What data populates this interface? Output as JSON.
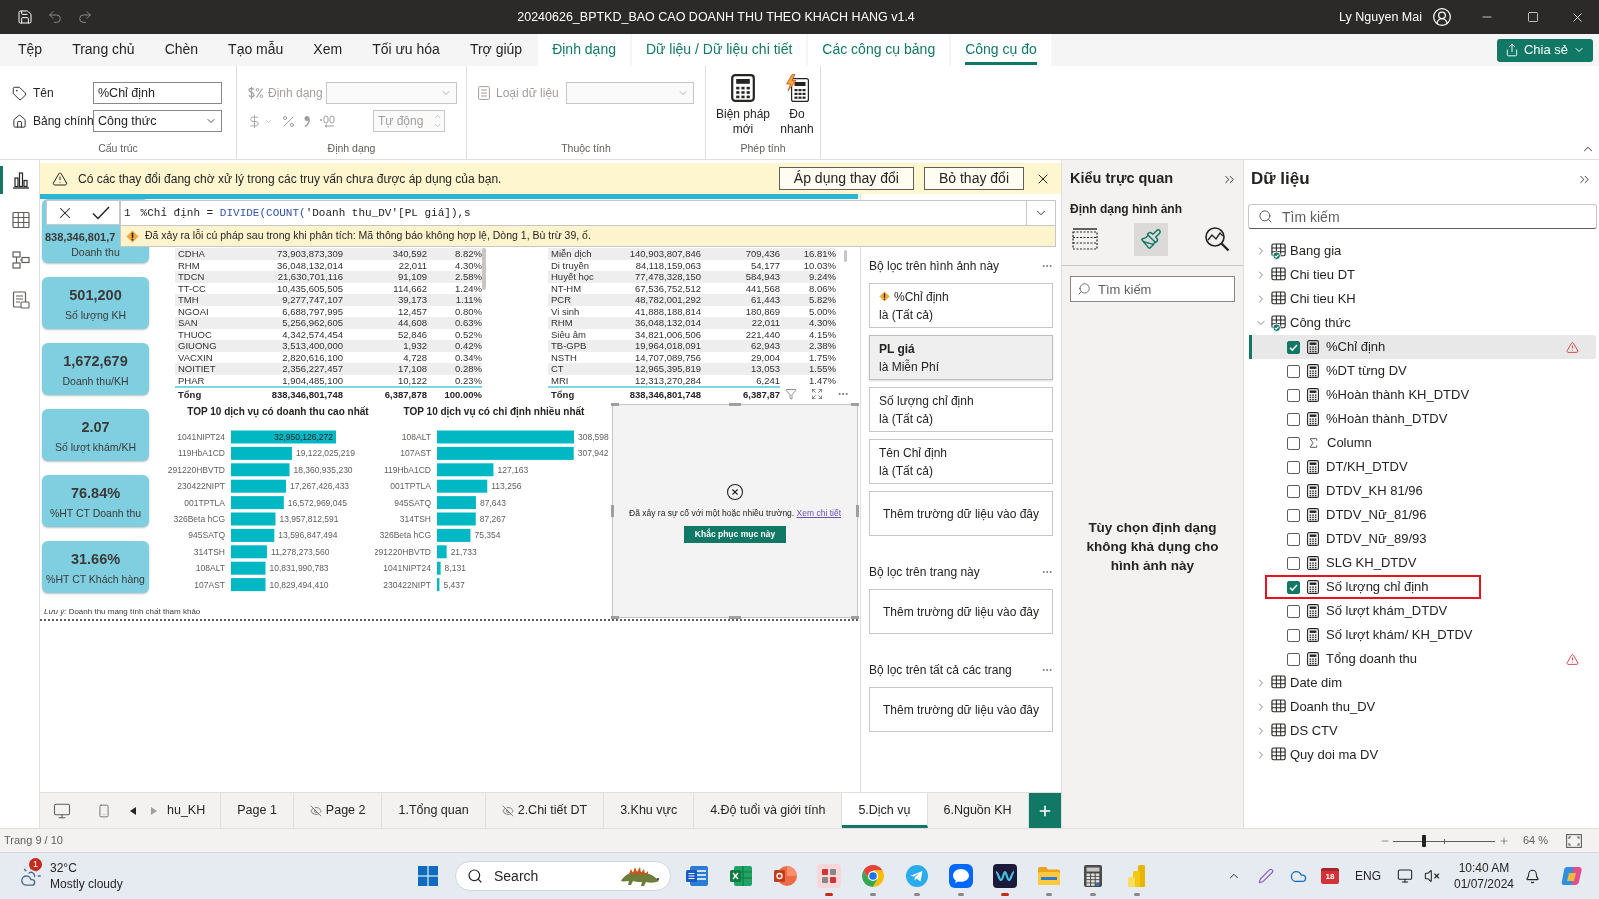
{
  "title_bar": {
    "title": "20240626_BPTKD_BAO CAO DOANH THU THEO KHACH HANG v1.4",
    "user": "Ly Nguyen Mai"
  },
  "menu_tabs": [
    {
      "label": "Tệp",
      "contextual": false,
      "selected": false
    },
    {
      "label": "Trang chủ",
      "contextual": false,
      "selected": false
    },
    {
      "label": "Chèn",
      "contextual": false,
      "selected": false
    },
    {
      "label": "Tạo mẫu",
      "contextual": false,
      "selected": false
    },
    {
      "label": "Xem",
      "contextual": false,
      "selected": false
    },
    {
      "label": "Tối ưu hóa",
      "contextual": false,
      "selected": false
    },
    {
      "label": "Trợ giúp",
      "contextual": false,
      "selected": false
    },
    {
      "label": "Định dạng",
      "contextual": true,
      "selected": false
    },
    {
      "label": "Dữ liệu / Dữ liệu chi tiết",
      "contextual": true,
      "selected": false
    },
    {
      "label": "Các công cụ bảng",
      "contextual": true,
      "selected": false
    },
    {
      "label": "Công cụ đo",
      "contextual": true,
      "selected": true
    }
  ],
  "share_button": {
    "label": "Chia sẻ"
  },
  "ribbon": {
    "structure": {
      "label": "Cấu trúc",
      "name_label": "Tên",
      "name_value": "%Chỉ định",
      "home_table_label": "Bảng chính",
      "home_table_value": "Công thức"
    },
    "format": {
      "label": "Định dạng",
      "format_label": "Định dạng",
      "decimals_value": "Tự động",
      "disabled": true
    },
    "properties": {
      "label": "Thuộc tính",
      "data_type_label": "Loại dữ liệu",
      "disabled": true
    },
    "calculations": {
      "label": "Phép tính",
      "buttons": [
        {
          "label": "Biện pháp mới",
          "kind": "new_measure"
        },
        {
          "label": "Đo nhanh",
          "kind": "quick_measure"
        }
      ]
    }
  },
  "view_switcher": [
    {
      "kind": "report",
      "selected": true
    },
    {
      "kind": "table",
      "selected": false
    },
    {
      "kind": "model",
      "selected": false
    },
    {
      "kind": "dax",
      "selected": false
    }
  ],
  "pending_changes_bar": {
    "message": "Có các thay đổi đang chờ xử lý trong các truy vấn chưa được áp dụng của bạn.",
    "buttons": [
      "Áp dụng thay đổi",
      "Bỏ thay đổi"
    ]
  },
  "formula_bar": {
    "line_number": "1",
    "tokens": [
      {
        "kind": "plain",
        "text": "%Chỉ định = "
      },
      {
        "kind": "function",
        "text": "DIVIDE(COUNT("
      },
      {
        "kind": "plain",
        "text": "'Doanh thu_DV'[PL giá]),s"
      }
    ],
    "error": "Đã xảy ra lỗi cú pháp sau trong khi phân tích: Mã thông báo không hợp lệ, Dòng 1, Bù trừ 39, ố."
  },
  "report_page": {
    "kpi_cards": [
      {
        "value": "838,346,801,7",
        "label": "Doanh thu"
      },
      {
        "value": "501,200",
        "label": "Số lượng KH"
      },
      {
        "value": "1,672,679",
        "label": "Doanh thu/KH"
      },
      {
        "value": "2.07",
        "label": "Số lượt khám/KH"
      },
      {
        "value": "76.84%",
        "label": "%HT CT Doanh thu"
      },
      {
        "value": "31.66%",
        "label": "%HT CT Khách hàng"
      }
    ],
    "tables": [
      {
        "rows": [
          {
            "cells": [
              "CDHA",
              "73,903,873,309",
              "340,592",
              "8.82%"
            ]
          },
          {
            "cells": [
              "RHM",
              "36,048,132,014",
              "22,011",
              "4.30%"
            ]
          },
          {
            "cells": [
              "TDCN",
              "21,630,701,116",
              "91,109",
              "2.58%"
            ]
          },
          {
            "cells": [
              "TT-CC",
              "10,435,605,505",
              "114,662",
              "1.24%"
            ]
          },
          {
            "cells": [
              "TMH",
              "9,277,747,107",
              "39,173",
              "1.11%"
            ]
          },
          {
            "cells": [
              "NGOAI",
              "6,688,797,995",
              "12,457",
              "0.80%"
            ]
          },
          {
            "cells": [
              "SAN",
              "5,256,962,605",
              "44,608",
              "0.63%"
            ]
          },
          {
            "cells": [
              "THUOC",
              "4,342,574,454",
              "52,846",
              "0.52%"
            ]
          },
          {
            "cells": [
              "GIUONG",
              "3,513,400,000",
              "1,932",
              "0.42%"
            ]
          },
          {
            "cells": [
              "VACXIN",
              "2,820,616,100",
              "4,728",
              "0.34%"
            ]
          },
          {
            "cells": [
              "NOITIET",
              "2,356,227,457",
              "17,108",
              "0.28%"
            ]
          },
          {
            "cells": [
              "PHAR",
              "1,904,485,100",
              "10,122",
              "0.23%"
            ]
          }
        ],
        "total": {
          "cells": [
            "Tổng",
            "838,346,801,748",
            "6,387,878",
            "100.00%"
          ]
        }
      },
      {
        "rows": [
          {
            "cells": [
              "Miễn dịch",
              "140,903,807,846",
              "709,436",
              "16.81%"
            ]
          },
          {
            "cells": [
              "Di truyền",
              "84,118,159,063",
              "54,177",
              "10.03%"
            ]
          },
          {
            "cells": [
              "Huyết học",
              "77,478,328,150",
              "584,943",
              "9.24%"
            ]
          },
          {
            "cells": [
              "NT-HM",
              "67,536,752,512",
              "441,568",
              "8.06%"
            ]
          },
          {
            "cells": [
              "PCR",
              "48,782,001,292",
              "61,443",
              "5.82%"
            ]
          },
          {
            "cells": [
              "Vi sinh",
              "41,888,188,814",
              "180,869",
              "5.00%"
            ]
          },
          {
            "cells": [
              "RHM",
              "36,048,132,014",
              "22,011",
              "4.30%"
            ]
          },
          {
            "cells": [
              "Siêu âm",
              "34,821,006,506",
              "221,440",
              "4.15%"
            ]
          },
          {
            "cells": [
              "TB-GPB",
              "19,964,018,091",
              "62,943",
              "2.38%"
            ]
          },
          {
            "cells": [
              "NSTH",
              "14,707,089,756",
              "29,004",
              "1.75%"
            ]
          },
          {
            "cells": [
              "CT",
              "12,965,395,819",
              "13,053",
              "1.55%"
            ]
          },
          {
            "cells": [
              "MRI",
              "12,313,270,284",
              "6,241",
              "1.47%"
            ]
          }
        ],
        "total": {
          "cells": [
            "Tổng",
            "838,346,801,748",
            "6,387,87"
          ]
        }
      }
    ],
    "charts": [
      {
        "chart_data": {
          "type": "bar",
          "orientation": "horizontal",
          "title": "TOP 10 dịch vụ có doanh thu cao nhất",
          "categories": [
            "1041NIPT24",
            "119HbA1CD",
            "291220HBVTD",
            "230422NIPT",
            "001TPTLA",
            "326Beta hCG",
            "945SATQ",
            "314TSH",
            "108ALT",
            "107AST"
          ],
          "values": [
            32950126272,
            19122025219,
            18360935230,
            17267426433,
            16572969045,
            13957812591,
            13596847494,
            11278273560,
            10831990783,
            10829494410
          ],
          "value_labels": [
            "32,950,126,272",
            "19,122,025,219",
            "18,360,935,230",
            "17,267,426,433",
            "16,572,969,045",
            "13,957,812,591",
            "13,596,847,494",
            "11,278,273,560",
            "10,831,990,783",
            "10,829,494,410"
          ]
        }
      },
      {
        "chart_data": {
          "type": "bar",
          "orientation": "horizontal",
          "title": "TOP 10 dịch vụ có chỉ định nhiều nhất",
          "categories": [
            "108ALT",
            "107AST",
            "119HbA1CD",
            "001TPTLA",
            "945SATQ",
            "314TSH",
            "326Beta hCG",
            "291220HBVTD",
            "1041NIPT24",
            "230422NIPT"
          ],
          "values": [
            308598,
            307942,
            127163,
            113256,
            87643,
            87267,
            75354,
            21733,
            8131,
            5437
          ],
          "value_labels": [
            "308,598",
            "307,942",
            "127,163",
            "113,256",
            "87,643",
            "87,267",
            "75,354",
            "21,733",
            "8,131",
            "5,437"
          ]
        }
      }
    ],
    "error_visual": {
      "message": "Đã xảy ra sự cố với một hoặc nhiều trường.",
      "link": "Xem chi tiết",
      "button": "Khắc phục mục này"
    },
    "note": "*Lưu ý:* Doanh thu mang tính chất tham khảo"
  },
  "filters_pane": {
    "sections": [
      {
        "title": "Bộ lọc trên hình ảnh này",
        "filters": [
          {
            "field": "%Chỉ định",
            "condition": "là (Tất cả)",
            "applied": false,
            "warning": true
          },
          {
            "field": "PL giá",
            "condition": "là Miễn Phí",
            "applied": true,
            "warning": false
          },
          {
            "field": "Số lượng chỉ định",
            "condition": "là (Tất cả)",
            "applied": false,
            "warning": false
          },
          {
            "field": "Tên Chỉ định",
            "condition": "là (Tất cả)",
            "applied": false,
            "warning": false
          }
        ],
        "dropzone": "Thêm trường dữ liệu vào đây"
      },
      {
        "title": "Bộ lọc trên trang này",
        "dropzone": "Thêm trường dữ liệu vào đây"
      },
      {
        "title": "Bộ lọc trên tất cả các trang",
        "dropzone": "Thêm trường dữ liệu vào đây"
      }
    ]
  },
  "visualizations_pane": {
    "title": "Kiểu trực quan",
    "subtitle": "Định dạng hình ảnh",
    "tools": [
      {
        "kind": "build",
        "selected": false
      },
      {
        "kind": "format",
        "selected": true
      },
      {
        "kind": "analytics",
        "selected": false
      }
    ],
    "search_placeholder": "Tìm kiếm",
    "message": "Tùy chọn định dạng không khả dụng cho hình ảnh này"
  },
  "data_pane": {
    "title": "Dữ liệu",
    "search_placeholder": "Tìm kiếm",
    "tables": [
      {
        "name": "Bang gia",
        "expanded": false,
        "badge": true
      },
      {
        "name": "Chi tieu DT",
        "expanded": false,
        "badge": false
      },
      {
        "name": "Chi tieu KH",
        "expanded": false,
        "badge": false
      },
      {
        "name": "Công thức",
        "expanded": true,
        "badge": true,
        "children": [
          {
            "name": "%Chỉ định",
            "kind": "measure",
            "checked": true,
            "selected": true,
            "warning": true,
            "outlined": false
          },
          {
            "name": "%DT từng DV",
            "kind": "measure",
            "checked": false,
            "selected": false,
            "warning": false,
            "outlined": false
          },
          {
            "name": "%Hoàn thành KH_DTDV",
            "kind": "measure",
            "checked": false,
            "selected": false,
            "warning": false,
            "outlined": false
          },
          {
            "name": "%Hoàn thành_DTDV",
            "kind": "measure",
            "checked": false,
            "selected": false,
            "warning": false,
            "outlined": false
          },
          {
            "name": "Column",
            "kind": "column",
            "checked": false,
            "selected": false,
            "warning": false,
            "outlined": false
          },
          {
            "name": "DT/KH_DTDV",
            "kind": "measure",
            "checked": false,
            "selected": false,
            "warning": false,
            "outlined": false
          },
          {
            "name": "DTDV_KH 81/96",
            "kind": "measure",
            "checked": false,
            "selected": false,
            "warning": false,
            "outlined": false
          },
          {
            "name": "DTDV_Nữ_81/96",
            "kind": "measure",
            "checked": false,
            "selected": false,
            "warning": false,
            "outlined": false
          },
          {
            "name": "DTDV_Nữ_89/93",
            "kind": "measure",
            "checked": false,
            "selected": false,
            "warning": false,
            "outlined": false
          },
          {
            "name": "SLG KH_DTDV",
            "kind": "measure",
            "checked": false,
            "selected": false,
            "warning": false,
            "outlined": false
          },
          {
            "name": "Số lượng chỉ định",
            "kind": "measure",
            "checked": true,
            "selected": false,
            "warning": false,
            "outlined": true
          },
          {
            "name": "Số lượt khám_DTDV",
            "kind": "measure",
            "checked": false,
            "selected": false,
            "warning": false,
            "outlined": false
          },
          {
            "name": "Số lượt khám/ KH_DTDV",
            "kind": "measure",
            "checked": false,
            "selected": false,
            "warning": false,
            "outlined": false
          },
          {
            "name": "Tổng doanh thu",
            "kind": "measure",
            "checked": false,
            "selected": false,
            "warning": true,
            "outlined": false
          }
        ]
      },
      {
        "name": "Date dim",
        "expanded": false,
        "badge": false
      },
      {
        "name": "Doanh thu_DV",
        "expanded": false,
        "badge": false
      },
      {
        "name": "DS CTV",
        "expanded": false,
        "badge": false
      },
      {
        "name": "Quy doi ma DV",
        "expanded": false,
        "badge": false
      }
    ]
  },
  "page_tabs": [
    {
      "label": "hu_KH",
      "hidden": false,
      "selected": false
    },
    {
      "label": "Page 1",
      "hidden": false,
      "selected": false
    },
    {
      "label": "Page 2",
      "hidden": true,
      "selected": false
    },
    {
      "label": "1.Tổng quan",
      "hidden": false,
      "selected": false
    },
    {
      "label": "2.Chi tiết DT",
      "hidden": true,
      "selected": false
    },
    {
      "label": "3.Khu vực",
      "hidden": false,
      "selected": false
    },
    {
      "label": "4.Độ tuổi và giới tính",
      "hidden": false,
      "selected": false
    },
    {
      "label": "5.Dịch vụ",
      "hidden": false,
      "selected": true
    },
    {
      "label": "6.Nguồn KH",
      "hidden": false,
      "selected": false
    }
  ],
  "status_bar": {
    "page": "Trang 9 / 10",
    "zoom": "64 %",
    "zoom_slider": {
      "level": 0.3
    }
  },
  "taskbar": {
    "weather": {
      "badge": "1",
      "temperature": "32°C",
      "condition": "Mostly cloudy"
    },
    "search_placeholder": "Search",
    "apps": [
      {
        "kind": "word",
        "running": false,
        "attention": false
      },
      {
        "kind": "excel",
        "running": false,
        "attention": false
      },
      {
        "kind": "powerpoint",
        "running": false,
        "attention": false
      },
      {
        "kind": "grid_app",
        "running": true,
        "attention": true
      },
      {
        "kind": "browser",
        "running": true,
        "attention": false
      },
      {
        "kind": "telegram",
        "running": true,
        "attention": false
      },
      {
        "kind": "zalo",
        "running": true,
        "attention": false
      },
      {
        "kind": "wave_app",
        "running": true,
        "attention": true
      },
      {
        "kind": "explorer",
        "running": true,
        "attention": false
      },
      {
        "kind": "calculator",
        "running": true,
        "attention": false
      },
      {
        "kind": "powerbi",
        "running": true,
        "attention": false
      }
    ],
    "tray": [
      {
        "kind": "chevron"
      },
      {
        "kind": "pen"
      },
      {
        "kind": "cloud"
      },
      {
        "kind": "calendar",
        "label": "18"
      }
    ],
    "language": "ENG",
    "muted": true,
    "time": "10:40 AM",
    "date": "01/07/2024"
  }
}
